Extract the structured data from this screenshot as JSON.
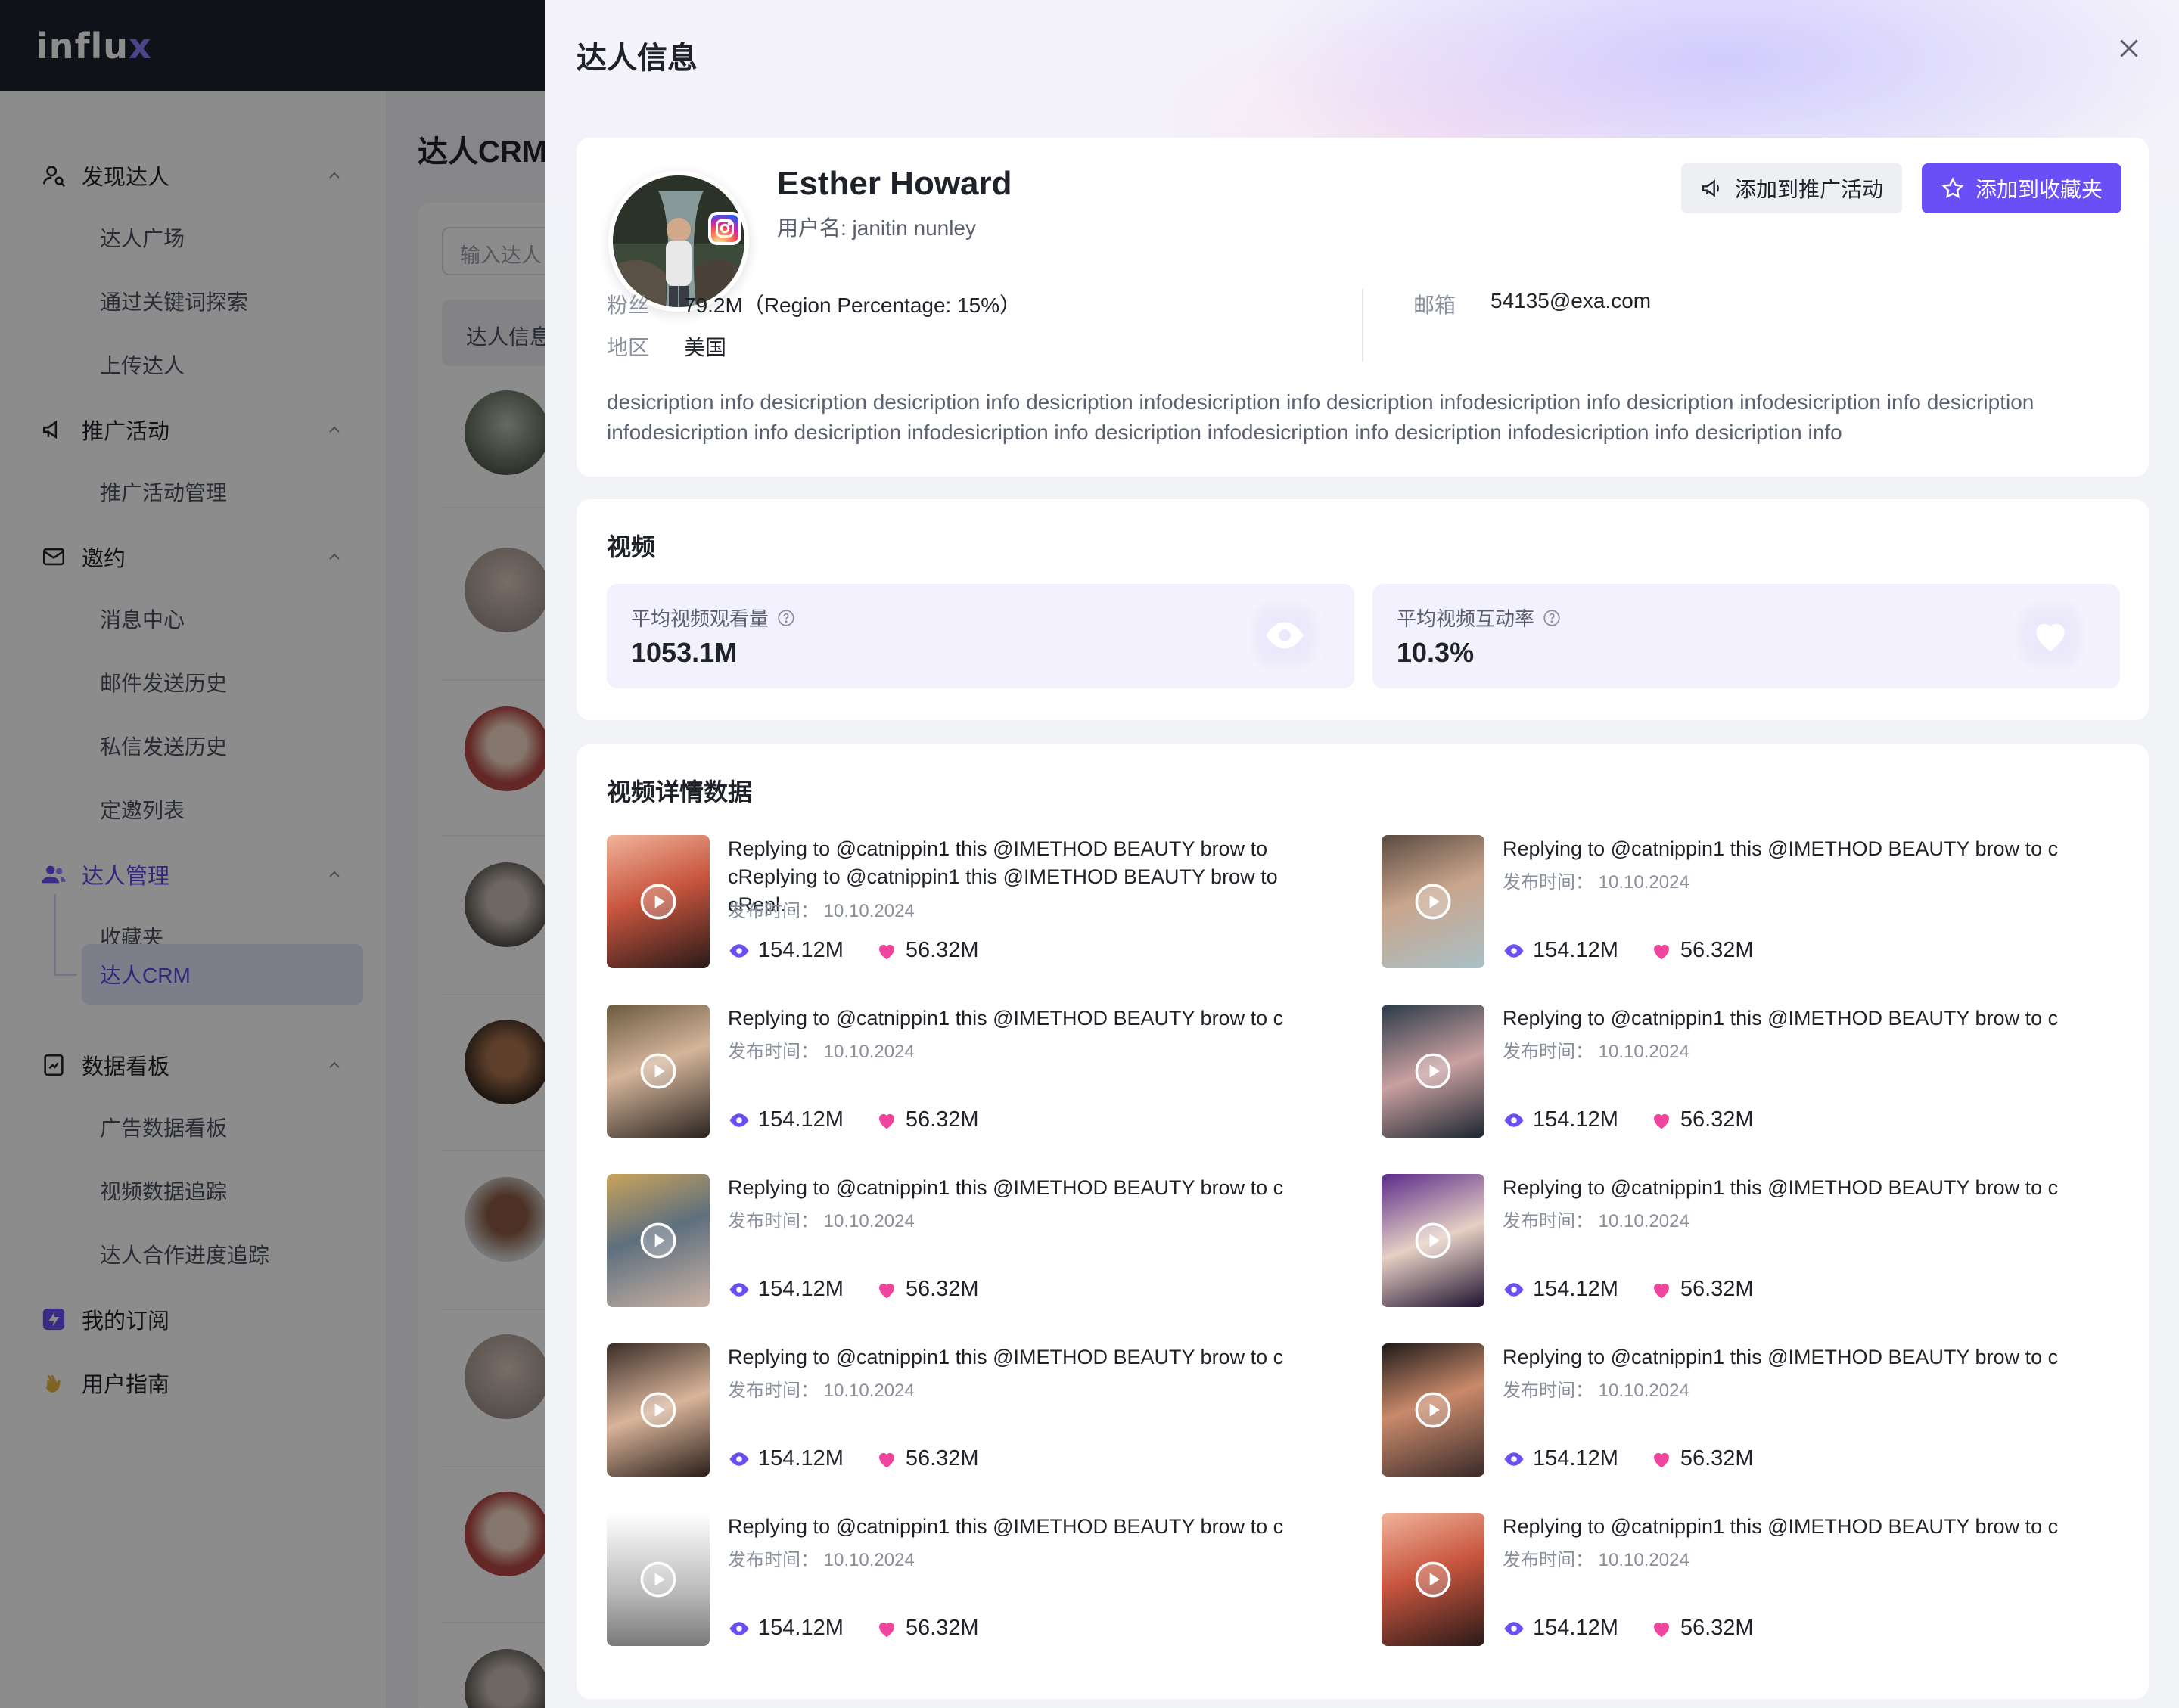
{
  "app": {
    "logo_main": "influ",
    "logo_accent": "x"
  },
  "sidebar": {
    "groups": [
      {
        "label": "发现达人",
        "items": [
          "达人广场",
          "通过关键词探索",
          "上传达人"
        ]
      },
      {
        "label": "推广活动",
        "items": [
          "推广活动管理"
        ]
      },
      {
        "label": "邀约",
        "items": [
          "消息中心",
          "邮件发送历史",
          "私信发送历史",
          "定邀列表"
        ]
      },
      {
        "label": "达人管理",
        "items": [
          "收藏夹",
          "达人CRM"
        ]
      },
      {
        "label": "数据看板",
        "items": [
          "广告数据看板",
          "视频数据追踪",
          "达人合作进度追踪"
        ]
      },
      {
        "label": "我的订阅"
      },
      {
        "label": "用户指南"
      }
    ],
    "active_item": "达人CRM"
  },
  "main": {
    "title": "达人CRM",
    "search_placeholder": "输入达人",
    "tab": "达人信息"
  },
  "drawer": {
    "title": "达人信息",
    "profile": {
      "name": "Esther Howard",
      "username": "用户名: janitin nunley",
      "btn_campaign": "添加到推广活动",
      "btn_favorite": "添加到收藏夹",
      "fans_label": "粉丝",
      "fans_value": "79.2M（Region Percentage: 15%）",
      "region_label": "地区",
      "region_value": "美国",
      "email_label": "邮箱",
      "email_value": "54135@exa.com",
      "description": "desicription info desicription  desicription info desicription infodesicription info desicription infodesicription info desicription infodesicription info desicription infodesicription info desicription infodesicription info desicription infodesicription info desicription infodesicription info desicription info"
    },
    "video_section": {
      "title": "视频",
      "avg_views_label": "平均视频观看量",
      "avg_views_value": "1053.1M",
      "avg_engagement_label": "平均视频互动率",
      "avg_engagement_value": "10.3%"
    },
    "detail_section": {
      "title": "视频详情数据",
      "date_label": "发布时间：",
      "videos": [
        {
          "title": "Replying to @catnippin1 this @IMETHOD BEAUTY brow to cReplying to @catnippin1 this @IMETHOD BEAUTY brow to cRepl...",
          "date": "10.10.2024",
          "views": "154.12M",
          "likes": "56.32M"
        },
        {
          "title": "Replying to @catnippin1 this @IMETHOD BEAUTY brow to c",
          "date": "10.10.2024",
          "views": "154.12M",
          "likes": "56.32M"
        },
        {
          "title": "Replying to @catnippin1 this @IMETHOD BEAUTY brow to c",
          "date": "10.10.2024",
          "views": "154.12M",
          "likes": "56.32M"
        },
        {
          "title": "Replying to @catnippin1 this @IMETHOD BEAUTY brow to c",
          "date": "10.10.2024",
          "views": "154.12M",
          "likes": "56.32M"
        },
        {
          "title": "Replying to @catnippin1 this @IMETHOD BEAUTY brow to c",
          "date": "10.10.2024",
          "views": "154.12M",
          "likes": "56.32M"
        },
        {
          "title": "Replying to @catnippin1 this @IMETHOD BEAUTY brow to c",
          "date": "10.10.2024",
          "views": "154.12M",
          "likes": "56.32M"
        },
        {
          "title": "Replying to @catnippin1 this @IMETHOD BEAUTY brow to c",
          "date": "10.10.2024",
          "views": "154.12M",
          "likes": "56.32M"
        },
        {
          "title": "Replying to @catnippin1 this @IMETHOD BEAUTY brow to c",
          "date": "10.10.2024",
          "views": "154.12M",
          "likes": "56.32M"
        },
        {
          "title": "Replying to @catnippin1 this @IMETHOD BEAUTY brow to c",
          "date": "10.10.2024",
          "views": "154.12M",
          "likes": "56.32M"
        },
        {
          "title": "Replying to @catnippin1 this @IMETHOD BEAUTY brow to c",
          "date": "10.10.2024",
          "views": "154.12M",
          "likes": "56.32M"
        }
      ]
    }
  },
  "colors": {
    "accent": "#6b4ff6",
    "eye": "#6b4ff6",
    "heart": "#f0459c",
    "topbar": "#1e2230"
  }
}
